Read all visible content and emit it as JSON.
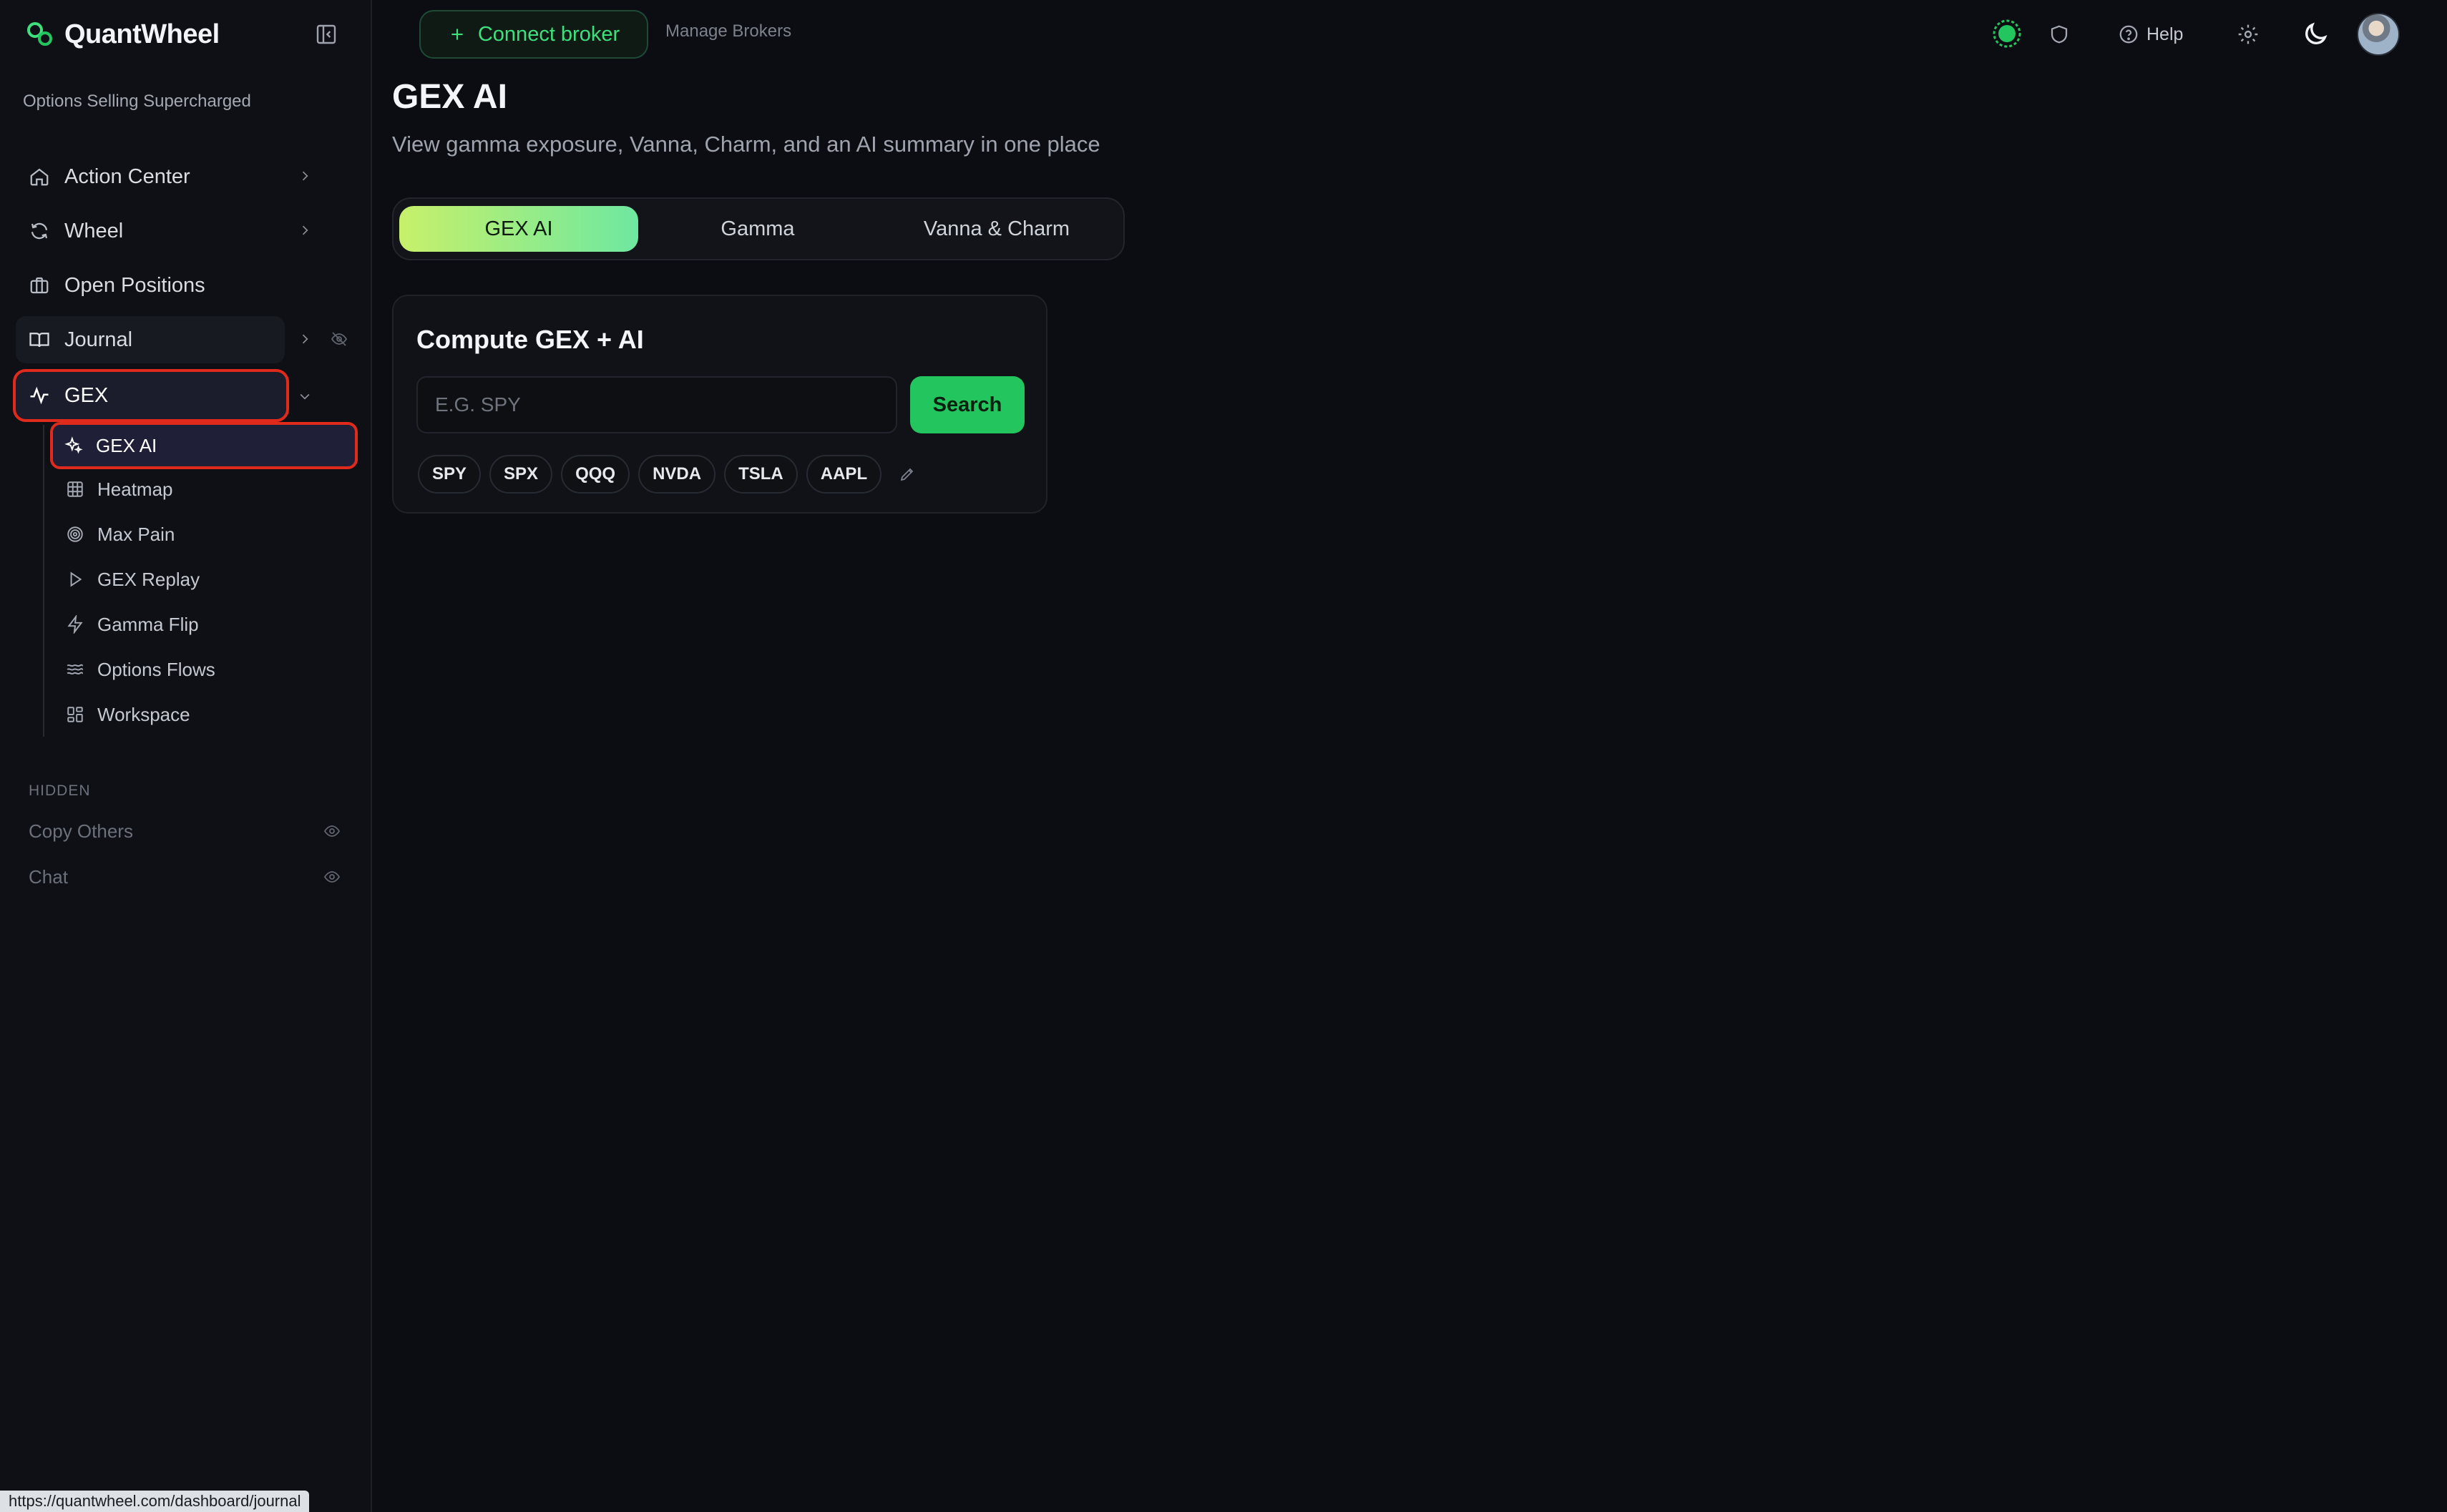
{
  "app": {
    "name": "QuantWheel",
    "tagline": "Options Selling Supercharged",
    "accent": "#22c55e",
    "highlight": "#e02a1c"
  },
  "sidebar": {
    "items": [
      {
        "label": "Action Center",
        "icon": "home-icon"
      },
      {
        "label": "Wheel",
        "icon": "refresh-icon"
      },
      {
        "label": "Open Positions",
        "icon": "briefcase-icon"
      },
      {
        "label": "Journal",
        "icon": "book-icon"
      },
      {
        "label": "GEX",
        "icon": "activity-icon"
      }
    ],
    "gex_sub": [
      {
        "label": "GEX AI",
        "icon": "sparkles-icon"
      },
      {
        "label": "Heatmap",
        "icon": "grid-icon"
      },
      {
        "label": "Max Pain",
        "icon": "target-icon"
      },
      {
        "label": "GEX Replay",
        "icon": "play-icon"
      },
      {
        "label": "Gamma Flip",
        "icon": "zap-icon"
      },
      {
        "label": "Options Flows",
        "icon": "waves-icon"
      },
      {
        "label": "Workspace",
        "icon": "layout-icon"
      }
    ],
    "hidden_title": "HIDDEN",
    "hidden_items": [
      {
        "label": "Copy Others"
      },
      {
        "label": "Chat"
      }
    ]
  },
  "topbar": {
    "connect_broker": "Connect broker",
    "manage_brokers": "Manage Brokers",
    "help": "Help"
  },
  "main": {
    "title": "GEX AI",
    "subtitle": "View gamma exposure, Vanna, Charm, and an AI summary in one place",
    "tabs": [
      {
        "label": "GEX AI"
      },
      {
        "label": "Gamma"
      },
      {
        "label": "Vanna & Charm"
      }
    ],
    "card": {
      "title": "Compute GEX + AI",
      "placeholder": "E.G. SPY",
      "search_label": "Search",
      "chips": [
        "SPY",
        "SPX",
        "QQQ",
        "NVDA",
        "TSLA",
        "AAPL"
      ]
    }
  },
  "status_url": "https://quantwheel.com/dashboard/journal"
}
